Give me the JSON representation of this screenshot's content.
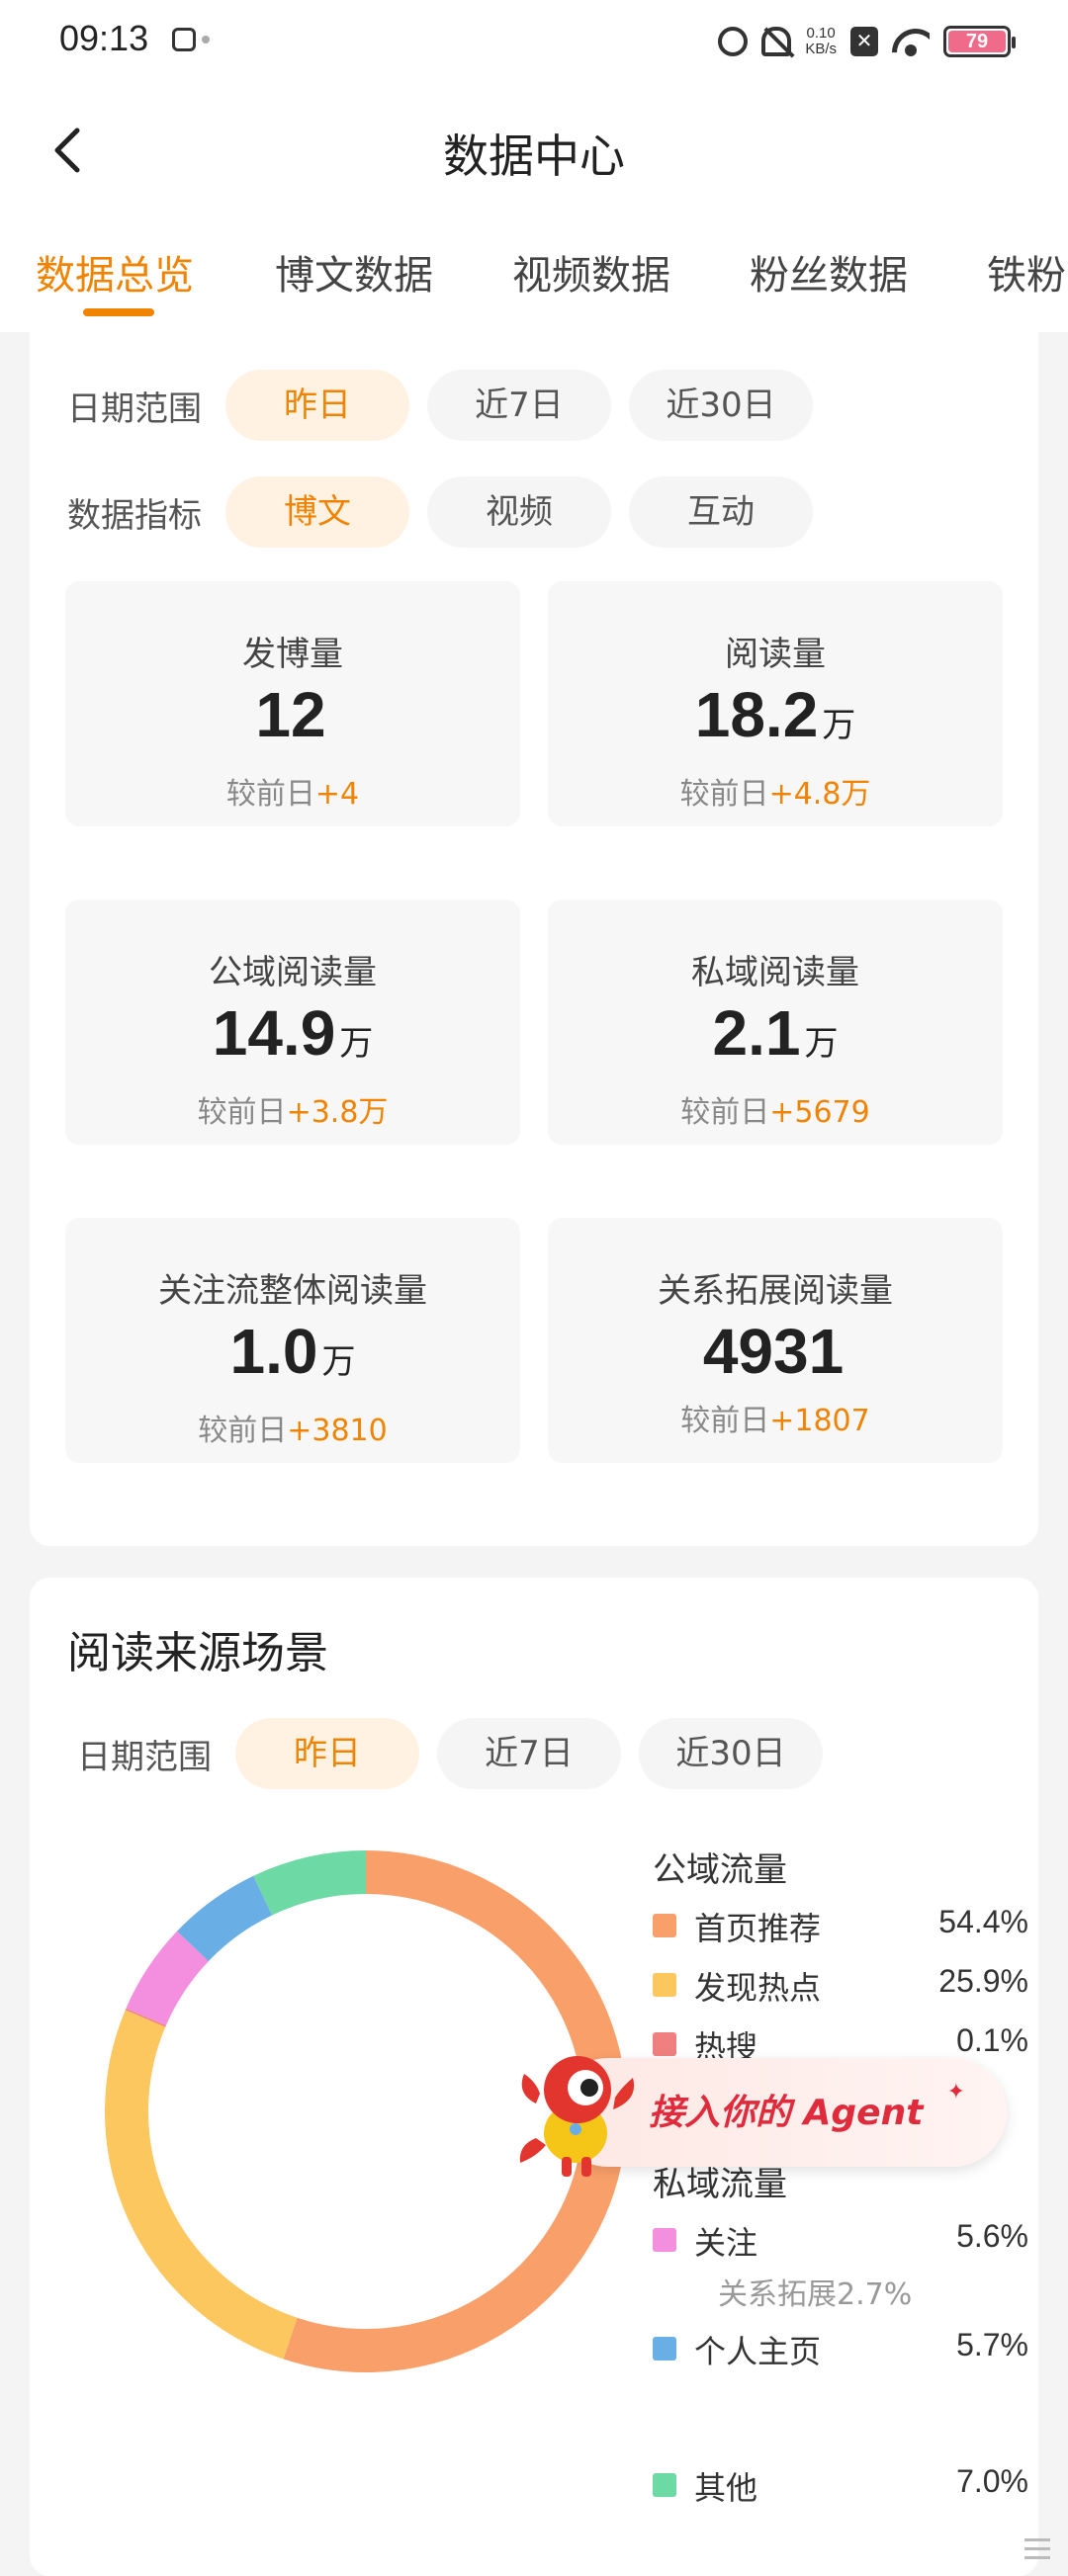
{
  "status_bar": {
    "time": "09:13",
    "net_speed_value": "0.10",
    "net_speed_unit": "KB/s",
    "battery": "79",
    "icons": [
      "alarm-icon",
      "mute-icon",
      "close-box-icon",
      "wifi-icon",
      "battery-icon"
    ]
  },
  "header": {
    "title": "数据中心"
  },
  "tabs": [
    {
      "label": "数据总览",
      "active": true
    },
    {
      "label": "博文数据",
      "active": false
    },
    {
      "label": "视频数据",
      "active": false
    },
    {
      "label": "粉丝数据",
      "active": false
    },
    {
      "label": "铁粉",
      "active": false
    }
  ],
  "overview": {
    "date_label": "日期范围",
    "date_chips": [
      "昨日",
      "近7日",
      "近30日"
    ],
    "date_selected": 0,
    "metric_label": "数据指标",
    "metric_chips": [
      "博文",
      "视频",
      "互动"
    ],
    "metric_selected": 0,
    "compare_prefix": "较前日",
    "metrics": [
      {
        "label": "发博量",
        "value": "12",
        "unit": "",
        "delta": "+4"
      },
      {
        "label": "阅读量",
        "value": "18.2",
        "unit": "万",
        "delta": "+4.8万"
      },
      {
        "label": "公域阅读量",
        "value": "14.9",
        "unit": "万",
        "delta": "+3.8万"
      },
      {
        "label": "私域阅读量",
        "value": "2.1",
        "unit": "万",
        "delta": "+5679"
      },
      {
        "label": "关注流整体阅读量",
        "value": "1.0",
        "unit": "万",
        "delta": "+3810"
      },
      {
        "label": "关系拓展阅读量",
        "value": "4931",
        "unit": "",
        "delta": "+1807"
      }
    ]
  },
  "sources": {
    "title": "阅读来源场景",
    "date_label": "日期范围",
    "date_chips": [
      "昨日",
      "近7日",
      "近30日"
    ],
    "date_selected": 0,
    "public_group": "公域流量",
    "private_group": "私域流量",
    "items": [
      {
        "name": "首页推荐",
        "pct": "54.4%",
        "color": "#f9a06a"
      },
      {
        "name": "发现热点",
        "pct": "25.9%",
        "color": "#fbc75e"
      },
      {
        "name": "热搜",
        "pct": "0.1%",
        "color": "#f08080"
      },
      {
        "name": "关注",
        "pct": "5.6%",
        "color": "#f48fe0"
      },
      {
        "name": "个人主页",
        "pct": "5.7%",
        "color": "#6aaee6"
      },
      {
        "name": "其他",
        "pct": "7.0%",
        "color": "#6dd9a4"
      }
    ],
    "sub_note": "关系拓展2.7%"
  },
  "chart_data": {
    "type": "pie",
    "categories": [
      "首页推荐",
      "发现热点",
      "热搜",
      "关注",
      "个人主页",
      "其他"
    ],
    "values": [
      54.4,
      25.9,
      0.1,
      5.6,
      5.7,
      7.0
    ],
    "colors": [
      "#f9a06a",
      "#fbc75e",
      "#f08080",
      "#f48fe0",
      "#6aaee6",
      "#6dd9a4"
    ],
    "title": "阅读来源场景",
    "legend_position": "right"
  },
  "agent_banner": {
    "text": "接入你的 Agent"
  }
}
